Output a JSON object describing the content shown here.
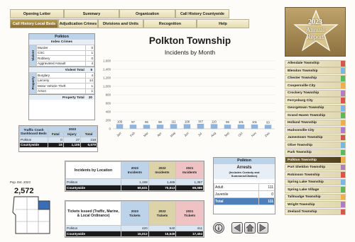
{
  "tabs_top": [
    {
      "label": "Opening Letter"
    },
    {
      "label": "Summary"
    },
    {
      "label": "Organization"
    },
    {
      "label": "Call History Countywide"
    }
  ],
  "tabs_second": [
    {
      "label": "Call History Local Beds"
    },
    {
      "label": "Adjudication Crimes"
    },
    {
      "label": "Divisions and Units"
    },
    {
      "label": "Recognition"
    },
    {
      "label": "Help"
    }
  ],
  "emblem": {
    "year": "2023",
    "line1": "Annual",
    "line2": "Report"
  },
  "township_list": [
    "Allendale Township",
    "Blendon Township",
    "Chester Township",
    "Coopersville City",
    "Crockery Township",
    "Ferrysburg City",
    "Georgetown Township",
    "Grand Haven Township",
    "Holland Township",
    "Hudsonville City",
    "Jamestown Township",
    "Olive Township",
    "Park Township",
    "Polkton Township",
    "Port Sheldon Township",
    "Robinson Township",
    "Spring Lake Township",
    "Spring Lake Village",
    "Tallmadge Township",
    "Wright Township",
    "Zeeland Township"
  ],
  "selected_township": "Polkton Township",
  "index_crimes": {
    "title": "Polkton",
    "subtitle": "Index Crimes",
    "violent_label": "Violent",
    "property_label": "Property",
    "violent_rows": [
      {
        "label": "Murder",
        "value": "0"
      },
      {
        "label": "CSC",
        "value": "1"
      },
      {
        "label": "Robbery",
        "value": "0"
      },
      {
        "label": "Aggravated Assault",
        "value": "4"
      }
    ],
    "violent_total_label": "Violent Total",
    "violent_total": "5",
    "property_rows": [
      {
        "label": "Burglary",
        "value": "4"
      },
      {
        "label": "Larceny",
        "value": "14"
      },
      {
        "label": "Motor Vehicle Theft",
        "value": "1"
      },
      {
        "label": "Arson",
        "value": "1"
      }
    ],
    "property_total_label": "Property Total",
    "property_total": "20"
  },
  "traffic": {
    "title": "Traffic Crash Dashboard Beds",
    "year": "2023",
    "cols": [
      "Fatal",
      "Injury",
      "Total"
    ],
    "rows": [
      {
        "label": "Polkton",
        "v": [
          "0",
          "27",
          "218"
        ]
      },
      {
        "label": "Countywide",
        "v": [
          "18",
          "1,106",
          "6,679"
        ]
      }
    ]
  },
  "population": {
    "label": "Pop. Est. 2023",
    "value": "2,572"
  },
  "main_title": "Polkton Township",
  "main_subtitle": "Incidents by Month",
  "incidents_loc": {
    "header": "Incidents by Location",
    "cols": [
      {
        "year": "2023",
        "sub": "Incidents"
      },
      {
        "year": "2022",
        "sub": "Incidents"
      },
      {
        "year": "2021",
        "sub": "Incidents"
      }
    ],
    "rows": [
      {
        "label": "Polkton",
        "v": [
          "1,199",
          "1,465",
          "1,357"
        ]
      },
      {
        "label": "Countywide",
        "v": [
          "69,631",
          "70,513",
          "69,089"
        ]
      }
    ]
  },
  "tickets": {
    "header": "Tickets Issued (Traffic, Marine, & Local Ordinance)",
    "cols": [
      {
        "year": "2023",
        "sub": "Tickets"
      },
      {
        "year": "2022",
        "sub": "Tickets"
      },
      {
        "year": "2021",
        "sub": "Tickets"
      }
    ],
    "rows": [
      {
        "label": "Polkton",
        "v": [
          "420",
          "540",
          "411"
        ]
      },
      {
        "label": "Countywide",
        "v": [
          "15,012",
          "15,549",
          "17,404"
        ]
      }
    ]
  },
  "arrests": {
    "title": "Polkton",
    "header": "Arrests",
    "note": "(Includes Custody and Summons/Citation)",
    "rows": [
      {
        "label": "Adult",
        "value": "111"
      },
      {
        "label": "Juvenile",
        "value": "0"
      }
    ],
    "total_label": "Total",
    "total": "111"
  },
  "chart_data": {
    "type": "bar",
    "title": "Polkton Township",
    "subtitle": "Incidents by Month",
    "categories": [
      "Jan",
      "Feb",
      "Mar",
      "Apr",
      "May",
      "Jun",
      "Jul",
      "Aug",
      "Sep",
      "Oct",
      "Nov",
      "Dec"
    ],
    "values": [
      109,
      97,
      96,
      98,
      111,
      108,
      117,
      110,
      98,
      101,
      101,
      93
    ],
    "ylim": [
      0,
      1600
    ],
    "yticks": [
      0,
      200,
      400,
      600,
      800,
      1000,
      1200,
      1400,
      1600
    ],
    "ytick_labels": [
      "0",
      "200",
      "400",
      "600",
      "800",
      "1,000",
      "1,200",
      "1,400",
      "1,600"
    ],
    "bar_color": "#8fb4dc",
    "grid": true
  }
}
